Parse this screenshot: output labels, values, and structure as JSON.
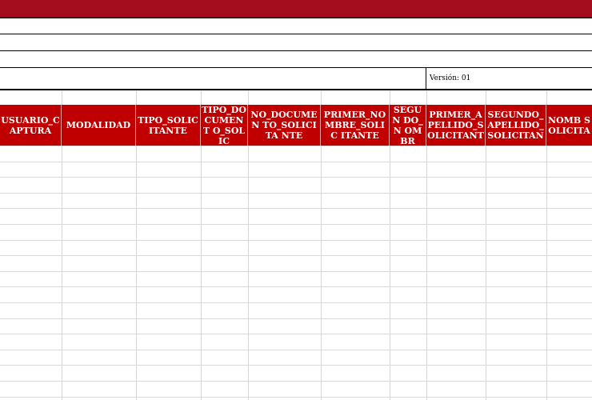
{
  "sheet": {
    "banner_color": "#a30d1e",
    "header_fill": "#c00000",
    "version_label": "Versión: 01",
    "columns": [
      {
        "key": "usuario_captura",
        "label": "USUARIO_C APTURA"
      },
      {
        "key": "modalidad",
        "label": "MODALIDAD"
      },
      {
        "key": "tipo_solicitante",
        "label": "TIPO_SOLIC ITANTE"
      },
      {
        "key": "tipo_documento",
        "label": "TIPO_DO CUMENT O_SOLIC"
      },
      {
        "key": "no_documento",
        "label": "NO_DOCUMEN TO_SOLICITA NTE"
      },
      {
        "key": "primer_nombre",
        "label": "PRIMER_NO MBRE_SOLIC ITANTE"
      },
      {
        "key": "segundo_nombre",
        "label": "SEGUN DO_N OMBR"
      },
      {
        "key": "primer_apellido",
        "label": "PRIMER_A PELLIDO_S OLICITANT"
      },
      {
        "key": "segundo_apellido",
        "label": "SEGUNDO_ APELLIDO_ SOLICITAN"
      },
      {
        "key": "nombre_solicitante",
        "label": "NOMB SOLICITA"
      }
    ]
  }
}
